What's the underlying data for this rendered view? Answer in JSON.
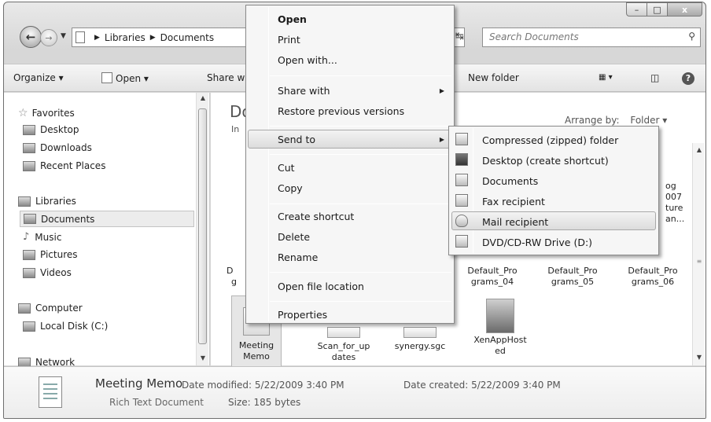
{
  "window": {
    "caption_buttons": {
      "minimize": "–",
      "maximize": "□",
      "close": "x"
    }
  },
  "address": {
    "path": [
      "Libraries",
      "Documents"
    ],
    "search_placeholder": "Search Documents"
  },
  "toolbar": {
    "organize": "Organize ▾",
    "open": "Open ▾",
    "share": "Share w",
    "new_folder": "New folder"
  },
  "nav": {
    "favorites": "Favorites",
    "desktop": "Desktop",
    "downloads": "Downloads",
    "recent": "Recent Places",
    "libraries": "Libraries",
    "documents": "Documents",
    "music": "Music",
    "pictures": "Pictures",
    "videos": "Videos",
    "computer": "Computer",
    "local_disk": "Local Disk (C:)",
    "network": "Network"
  },
  "content": {
    "title": "Do",
    "subtitle": "In",
    "arrange_label": "Arrange by:",
    "arrange_value": "Folder ▾",
    "files": {
      "partial_top_l1": "og",
      "partial_top_l2": "007",
      "partial_top_l3": "ture",
      "partial_top_l4": "an...",
      "partial_mid": "D",
      "partial_mid2": "g",
      "default4_l1": "Default_Pro",
      "default4_l2": "grams_04",
      "default5_l1": "Default_Pro",
      "default5_l2": "grams_05",
      "default6_l1": "Default_Pro",
      "default6_l2": "grams_06",
      "memo_l1": "Meeting",
      "memo_l2": "Memo",
      "scan_l1": "Scan_for_up",
      "scan_l2": "dates",
      "synergy": "synergy.sgc",
      "xen_l1": "XenAppHost",
      "xen_l2": "ed"
    }
  },
  "details": {
    "name": "Meeting Memo",
    "type": "Rich Text Document",
    "modified": "Date modified: 5/22/2009 3:40 PM",
    "size": "Size: 185 bytes",
    "created": "Date created: 5/22/2009 3:40 PM"
  },
  "context_menu": {
    "open": "Open",
    "print": "Print",
    "open_with": "Open with...",
    "share_with": "Share with",
    "restore": "Restore previous versions",
    "send_to": "Send to",
    "cut": "Cut",
    "copy": "Copy",
    "create_shortcut": "Create shortcut",
    "delete": "Delete",
    "rename": "Rename",
    "open_location": "Open file location",
    "properties": "Properties"
  },
  "send_to_menu": {
    "zip": "Compressed (zipped) folder",
    "desktop": "Desktop (create shortcut)",
    "documents": "Documents",
    "fax": "Fax recipient",
    "mail": "Mail recipient",
    "dvd": "DVD/CD-RW Drive (D:)"
  }
}
